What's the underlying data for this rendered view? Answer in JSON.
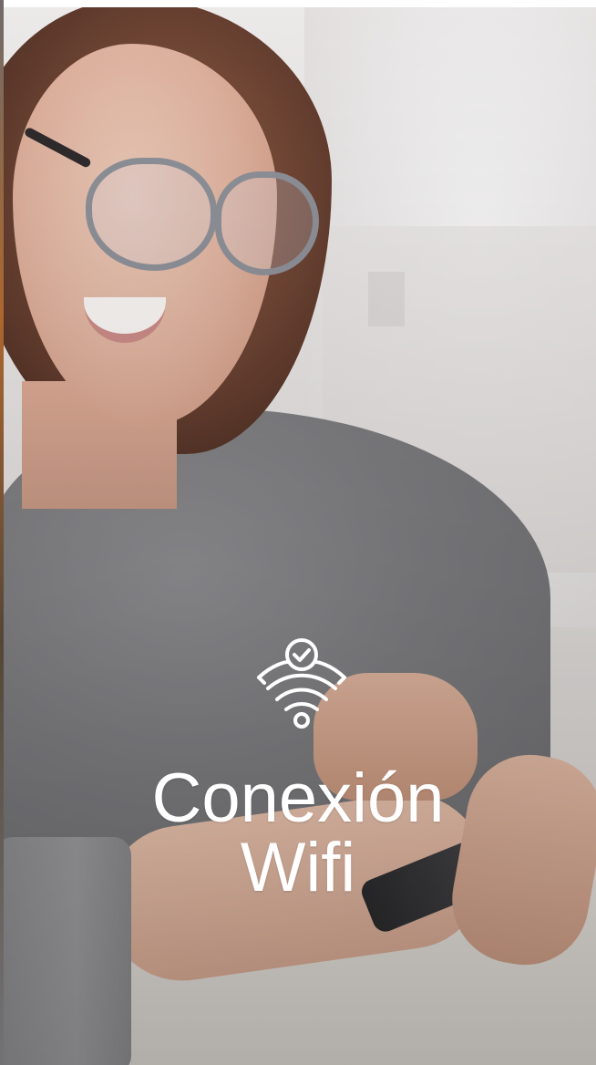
{
  "screen": {
    "title_line1": "Conexión",
    "title_line2": "Wifi",
    "icon": "wifi-check-icon",
    "colors": {
      "title_text": "#ffffff",
      "icon_stroke": "#ffffff"
    }
  }
}
